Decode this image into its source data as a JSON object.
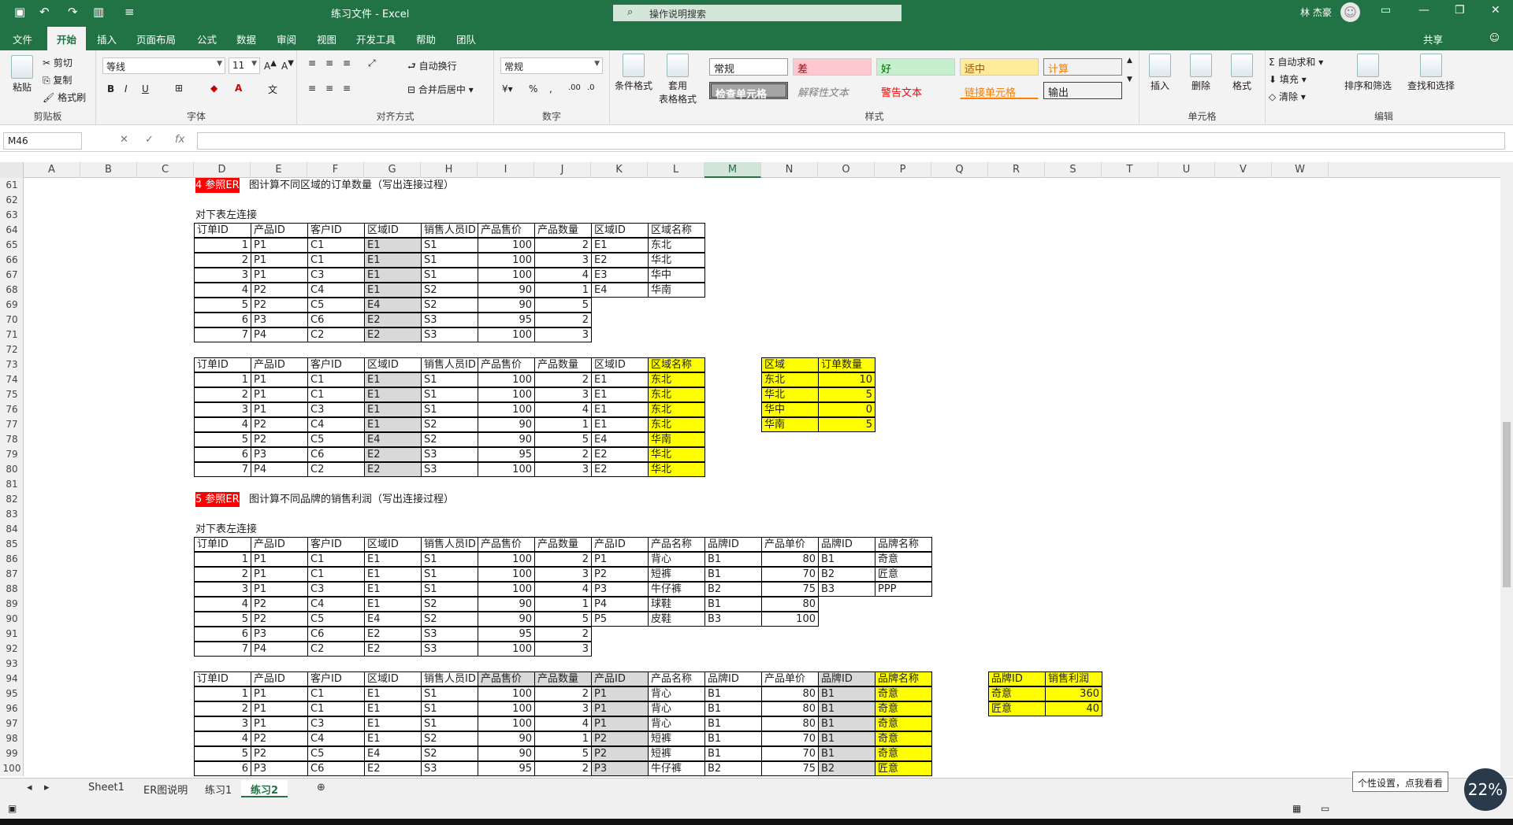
{
  "app": {
    "title": "练习文件 - Excel",
    "search_placeholder": "操作说明搜索",
    "user": "林 杰豪",
    "share": "共享"
  },
  "tabs": [
    "文件",
    "开始",
    "插入",
    "页面布局",
    "公式",
    "数据",
    "审阅",
    "视图",
    "开发工具",
    "帮助",
    "团队"
  ],
  "ribbon": {
    "clipboard": {
      "paste": "粘贴",
      "cut": "剪切",
      "copy": "复制",
      "painter": "格式刷",
      "label": "剪贴板"
    },
    "font": {
      "name": "等线",
      "size": "11",
      "bold": "B",
      "italic": "I",
      "underline": "U",
      "label": "字体"
    },
    "align": {
      "wrap": "自动换行",
      "merge": "合并后居中",
      "label": "对齐方式"
    },
    "number": {
      "format": "常规",
      "label": "数字"
    },
    "styles": {
      "cond": "条件格式",
      "table": "套用",
      "table2": "表格格式",
      "label": "样式",
      "cells": [
        "常规",
        "差",
        "好",
        "适中",
        "计算",
        "检查单元格",
        "解释性文本",
        "警告文本",
        "链接单元格",
        "输出"
      ]
    },
    "cellsgrp": {
      "insert": "插入",
      "delete": "删除",
      "format": "格式",
      "label": "单元格"
    },
    "edit": {
      "autosum": "自动求和",
      "fill": "填充",
      "clear": "清除",
      "sort": "排序和筛选",
      "find": "查找和选择",
      "label": "编辑"
    }
  },
  "namebox": "M46",
  "columns": [
    "A",
    "B",
    "C",
    "D",
    "E",
    "F",
    "G",
    "H",
    "I",
    "J",
    "K",
    "L",
    "M",
    "N",
    "O",
    "P",
    "Q",
    "R",
    "S",
    "T",
    "U",
    "V",
    "W"
  ],
  "rows": [
    "61",
    "62",
    "63",
    "64",
    "65",
    "66",
    "67",
    "68",
    "69",
    "70",
    "71",
    "72",
    "73",
    "74",
    "75",
    "76",
    "77",
    "78",
    "79",
    "80",
    "81",
    "82",
    "83",
    "84",
    "85",
    "86",
    "87",
    "88",
    "89",
    "90",
    "91",
    "92",
    "93",
    "94",
    "95",
    "96",
    "97",
    "98",
    "99",
    "100"
  ],
  "texts": {
    "q4_tag": "4 参照ER",
    "q4_rest": "图计算不同区域的订单数量（写出连接过程）",
    "left_join": "对下表左连接",
    "q5_tag": "5 参照ER",
    "q5_rest": "图计算不同品牌的销售利润（写出连接过程）"
  },
  "t1": {
    "headers": [
      "订单ID",
      "产品ID",
      "客户ID",
      "区域ID",
      "销售人员ID",
      "产品售价",
      "产品数量",
      "区域ID",
      "区域名称"
    ],
    "rows": [
      [
        "1",
        "P1",
        "C1",
        "E1",
        "S1",
        "100",
        "2"
      ],
      [
        "2",
        "P1",
        "C1",
        "E1",
        "S1",
        "100",
        "3"
      ],
      [
        "3",
        "P1",
        "C3",
        "E1",
        "S1",
        "100",
        "4"
      ],
      [
        "4",
        "P2",
        "C4",
        "E1",
        "S2",
        "90",
        "1"
      ],
      [
        "5",
        "P2",
        "C5",
        "E4",
        "S2",
        "90",
        "5"
      ],
      [
        "6",
        "P3",
        "C6",
        "E2",
        "S3",
        "95",
        "2"
      ],
      [
        "7",
        "P4",
        "C2",
        "E2",
        "S3",
        "100",
        "3"
      ]
    ],
    "region": [
      [
        "E1",
        "东北"
      ],
      [
        "E2",
        "华北"
      ],
      [
        "E3",
        "华中"
      ],
      [
        "E4",
        "华南"
      ]
    ]
  },
  "t2": {
    "rows": [
      [
        "1",
        "P1",
        "C1",
        "E1",
        "S1",
        "100",
        "2",
        "E1",
        "东北"
      ],
      [
        "2",
        "P1",
        "C1",
        "E1",
        "S1",
        "100",
        "3",
        "E1",
        "东北"
      ],
      [
        "3",
        "P1",
        "C3",
        "E1",
        "S1",
        "100",
        "4",
        "E1",
        "东北"
      ],
      [
        "4",
        "P2",
        "C4",
        "E1",
        "S2",
        "90",
        "1",
        "E1",
        "东北"
      ],
      [
        "5",
        "P2",
        "C5",
        "E4",
        "S2",
        "90",
        "5",
        "E4",
        "华南"
      ],
      [
        "6",
        "P3",
        "C6",
        "E2",
        "S3",
        "95",
        "2",
        "E2",
        "华北"
      ],
      [
        "7",
        "P4",
        "C2",
        "E2",
        "S3",
        "100",
        "3",
        "E2",
        "华北"
      ]
    ]
  },
  "summary1": {
    "headers": [
      "区域",
      "订单数量"
    ],
    "rows": [
      [
        "东北",
        "10"
      ],
      [
        "华北",
        "5"
      ],
      [
        "华中",
        "0"
      ],
      [
        "华南",
        "5"
      ]
    ]
  },
  "t3": {
    "headers": [
      "订单ID",
      "产品ID",
      "客户ID",
      "区域ID",
      "销售人员ID",
      "产品售价",
      "产品数量",
      "产品ID",
      "产品名称",
      "品牌ID",
      "产品单价",
      "品牌ID",
      "品牌名称"
    ],
    "orders": [
      [
        "1",
        "P1",
        "C1",
        "E1",
        "S1",
        "100",
        "2"
      ],
      [
        "2",
        "P1",
        "C1",
        "E1",
        "S1",
        "100",
        "3"
      ],
      [
        "3",
        "P1",
        "C3",
        "E1",
        "S1",
        "100",
        "4"
      ],
      [
        "4",
        "P2",
        "C4",
        "E1",
        "S2",
        "90",
        "1"
      ],
      [
        "5",
        "P2",
        "C5",
        "E4",
        "S2",
        "90",
        "5"
      ],
      [
        "6",
        "P3",
        "C6",
        "E2",
        "S3",
        "95",
        "2"
      ],
      [
        "7",
        "P4",
        "C2",
        "E2",
        "S3",
        "100",
        "3"
      ]
    ],
    "products": [
      [
        "P1",
        "背心",
        "B1",
        "80"
      ],
      [
        "P2",
        "短裤",
        "B1",
        "70"
      ],
      [
        "P3",
        "牛仔裤",
        "B2",
        "75"
      ],
      [
        "P4",
        "球鞋",
        "B1",
        "80"
      ],
      [
        "P5",
        "皮鞋",
        "B3",
        "100"
      ]
    ],
    "brands": [
      [
        "B1",
        "奇意"
      ],
      [
        "B2",
        "匠意"
      ],
      [
        "B3",
        "PPP"
      ]
    ]
  },
  "t4": {
    "rows": [
      [
        "1",
        "P1",
        "C1",
        "E1",
        "S1",
        "100",
        "2",
        "P1",
        "背心",
        "B1",
        "80",
        "B1",
        "奇意"
      ],
      [
        "2",
        "P1",
        "C1",
        "E1",
        "S1",
        "100",
        "3",
        "P1",
        "背心",
        "B1",
        "80",
        "B1",
        "奇意"
      ],
      [
        "3",
        "P1",
        "C3",
        "E1",
        "S1",
        "100",
        "4",
        "P1",
        "背心",
        "B1",
        "80",
        "B1",
        "奇意"
      ],
      [
        "4",
        "P2",
        "C4",
        "E1",
        "S2",
        "90",
        "1",
        "P2",
        "短裤",
        "B1",
        "70",
        "B1",
        "奇意"
      ],
      [
        "5",
        "P2",
        "C5",
        "E4",
        "S2",
        "90",
        "5",
        "P2",
        "短裤",
        "B1",
        "70",
        "B1",
        "奇意"
      ],
      [
        "6",
        "P3",
        "C6",
        "E2",
        "S3",
        "95",
        "2",
        "P3",
        "牛仔裤",
        "B2",
        "75",
        "B2",
        "匠意"
      ]
    ]
  },
  "summary2": {
    "headers": [
      "品牌ID",
      "销售利润"
    ],
    "rows": [
      [
        "奇意",
        "360"
      ],
      [
        "匠意",
        "40"
      ]
    ]
  },
  "sheets": [
    "Sheet1",
    "ER图说明",
    "练习1",
    "练习2"
  ],
  "tip": "个性设置，点我看看",
  "zoom": "22%"
}
